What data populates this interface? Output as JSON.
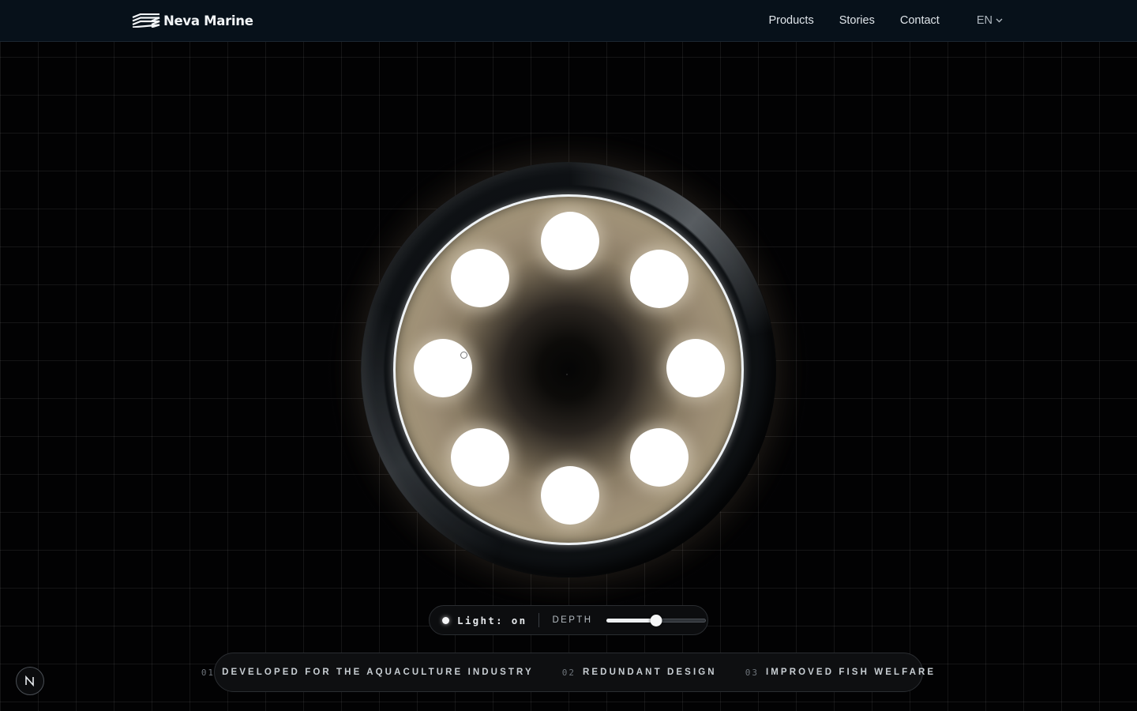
{
  "header": {
    "brand": "Neva Marine",
    "nav": [
      {
        "label": "Products"
      },
      {
        "label": "Stories"
      },
      {
        "label": "Contact"
      }
    ],
    "language": "EN"
  },
  "controls": {
    "light_label": "Light: on",
    "depth_label": "DEPTH",
    "depth_value": 0.5
  },
  "features": [
    {
      "num": "01",
      "label": "DEVELOPED FOR THE AQUACULTURE INDUSTRY"
    },
    {
      "num": "02",
      "label": "REDUNDANT DESIGN"
    },
    {
      "num": "03",
      "label": "IMPROVED FISH WELFARE"
    }
  ],
  "icons": {
    "logo": "wave-stripes-logo-icon",
    "language_caret": "chevron-down-icon",
    "badge": "n-letter-icon"
  }
}
